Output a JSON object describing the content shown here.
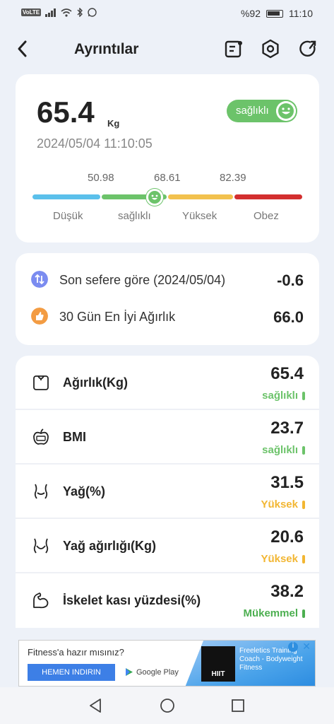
{
  "status_bar": {
    "volte": "VoLTE",
    "battery": "%92",
    "time": "11:10"
  },
  "header": {
    "title": "Ayrıntılar"
  },
  "summary": {
    "weight": "65.4",
    "unit": "Kg",
    "datetime": "2024/05/04 11:10:05",
    "status": "sağlıklı",
    "thresholds": [
      "50.98",
      "68.61",
      "82.39"
    ],
    "ranges": [
      "Düşük",
      "sağlıklı",
      "Yüksek",
      "Obez"
    ],
    "colors": {
      "low": "#5bc0eb",
      "healthy": "#6cc36a",
      "high": "#f2c14e",
      "obese": "#d32f2f"
    }
  },
  "comparison": [
    {
      "label": "Son sefere göre (2024/05/04)",
      "value": "-0.6",
      "icon": "compare-arrows-icon",
      "color": "#7b8cf0"
    },
    {
      "label": "30 Gün En İyi Ağırlık",
      "value": "66.0",
      "icon": "thumbs-up-icon",
      "color": "#f39c43"
    }
  ],
  "metrics": [
    {
      "label": "Ağırlık(Kg)",
      "value": "65.4",
      "status": "sağlıklı",
      "color": "#6cc36a",
      "icon": "scale-icon"
    },
    {
      "label": "BMI",
      "value": "23.7",
      "status": "sağlıklı",
      "color": "#6cc36a",
      "icon": "apple-icon"
    },
    {
      "label": "Yağ(%)",
      "value": "31.5",
      "status": "Yüksek",
      "color": "#f2b632",
      "icon": "body-fat-icon"
    },
    {
      "label": "Yağ ağırlığı(Kg)",
      "value": "20.6",
      "status": "Yüksek",
      "color": "#f2b632",
      "icon": "fat-weight-icon"
    },
    {
      "label": "İskelet kası yüzdesi(%)",
      "value": "38.2",
      "status": "Mükemmel",
      "color": "#4caf50",
      "icon": "muscle-icon"
    }
  ],
  "ad": {
    "question": "Fitness'a hazır mısınız?",
    "button": "HEMEN INDIRIN",
    "store": "Google Play",
    "brand": "HIIT",
    "text": "Freeletics Training Coach - Bodyweight Fitness",
    "info": "i",
    "close": "✕"
  }
}
